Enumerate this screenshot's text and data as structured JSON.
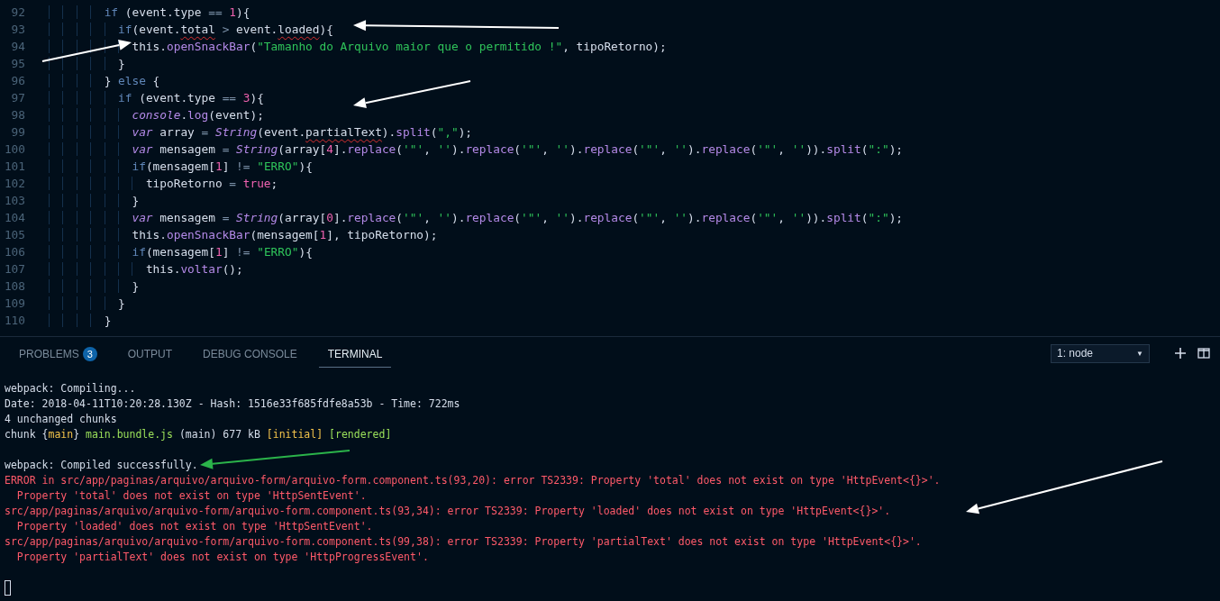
{
  "editor": {
    "lines": [
      {
        "number": "92",
        "tokens": [
          {
            "kind": "keyword",
            "text": "        if"
          },
          {
            "kind": "plain",
            "text": " (event.type "
          },
          {
            "kind": "operator",
            "text": "=="
          },
          {
            "kind": "number",
            "text": " 1"
          },
          {
            "kind": "plain",
            "text": "){"
          }
        ]
      },
      {
        "number": "93",
        "tokens": [
          {
            "kind": "keyword",
            "text": "          if"
          },
          {
            "kind": "plain",
            "text": "(event."
          },
          {
            "kind": "error",
            "text": "total"
          },
          {
            "kind": "operator",
            "text": " >"
          },
          {
            "kind": "plain",
            "text": " event."
          },
          {
            "kind": "error",
            "text": "loaded"
          },
          {
            "kind": "plain",
            "text": "){"
          }
        ]
      },
      {
        "number": "94",
        "tokens": [
          {
            "kind": "plain",
            "text": "            this."
          },
          {
            "kind": "function",
            "text": "openSnackBar"
          },
          {
            "kind": "plain",
            "text": "("
          },
          {
            "kind": "string",
            "text": "\"Tamanho do Arquivo maior que o permitido !\""
          },
          {
            "kind": "plain",
            "text": ", tipoRetorno);"
          }
        ]
      },
      {
        "number": "95",
        "tokens": [
          {
            "kind": "plain",
            "text": "          }"
          }
        ]
      },
      {
        "number": "96",
        "tokens": [
          {
            "kind": "plain",
            "text": "        } "
          },
          {
            "kind": "keyword",
            "text": "else"
          },
          {
            "kind": "plain",
            "text": " {"
          }
        ]
      },
      {
        "number": "97",
        "tokens": [
          {
            "kind": "keyword",
            "text": "          if"
          },
          {
            "kind": "plain",
            "text": " (event.type "
          },
          {
            "kind": "operator",
            "text": "=="
          },
          {
            "kind": "number",
            "text": " 3"
          },
          {
            "kind": "plain",
            "text": "){"
          }
        ]
      },
      {
        "number": "98",
        "tokens": [
          {
            "kind": "italic",
            "text": "            console"
          },
          {
            "kind": "plain",
            "text": "."
          },
          {
            "kind": "function",
            "text": "log"
          },
          {
            "kind": "plain",
            "text": "(event);"
          }
        ]
      },
      {
        "number": "99",
        "tokens": [
          {
            "kind": "italic",
            "text": "            var"
          },
          {
            "kind": "plain",
            "text": " array "
          },
          {
            "kind": "operator",
            "text": "="
          },
          {
            "kind": "italic",
            "text": " String"
          },
          {
            "kind": "plain",
            "text": "(event."
          },
          {
            "kind": "error",
            "text": "partialText"
          },
          {
            "kind": "plain",
            "text": ")."
          },
          {
            "kind": "function",
            "text": "split"
          },
          {
            "kind": "plain",
            "text": "("
          },
          {
            "kind": "string",
            "text": "\",\""
          },
          {
            "kind": "plain",
            "text": ");"
          }
        ]
      },
      {
        "number": "100",
        "tokens": [
          {
            "kind": "italic",
            "text": "            var"
          },
          {
            "kind": "plain",
            "text": " mensagem "
          },
          {
            "kind": "operator",
            "text": "="
          },
          {
            "kind": "italic",
            "text": " String"
          },
          {
            "kind": "plain",
            "text": "(array["
          },
          {
            "kind": "number",
            "text": "4"
          },
          {
            "kind": "plain",
            "text": "]."
          },
          {
            "kind": "function",
            "text": "replace"
          },
          {
            "kind": "plain",
            "text": "("
          },
          {
            "kind": "string",
            "text": "'\"'"
          },
          {
            "kind": "plain",
            "text": ", "
          },
          {
            "kind": "string",
            "text": "''"
          },
          {
            "kind": "plain",
            "text": ")."
          },
          {
            "kind": "function",
            "text": "replace"
          },
          {
            "kind": "plain",
            "text": "("
          },
          {
            "kind": "string",
            "text": "'\"'"
          },
          {
            "kind": "plain",
            "text": ", "
          },
          {
            "kind": "string",
            "text": "''"
          },
          {
            "kind": "plain",
            "text": ")."
          },
          {
            "kind": "function",
            "text": "replace"
          },
          {
            "kind": "plain",
            "text": "("
          },
          {
            "kind": "string",
            "text": "'\"'"
          },
          {
            "kind": "plain",
            "text": ", "
          },
          {
            "kind": "string",
            "text": "''"
          },
          {
            "kind": "plain",
            "text": ")."
          },
          {
            "kind": "function",
            "text": "replace"
          },
          {
            "kind": "plain",
            "text": "("
          },
          {
            "kind": "string",
            "text": "'\"'"
          },
          {
            "kind": "plain",
            "text": ", "
          },
          {
            "kind": "string",
            "text": "''"
          },
          {
            "kind": "plain",
            "text": "))."
          },
          {
            "kind": "function",
            "text": "split"
          },
          {
            "kind": "plain",
            "text": "("
          },
          {
            "kind": "string",
            "text": "\":\""
          },
          {
            "kind": "plain",
            "text": ");"
          }
        ]
      },
      {
        "number": "101",
        "tokens": [
          {
            "kind": "keyword",
            "text": "            if"
          },
          {
            "kind": "plain",
            "text": "(mensagem["
          },
          {
            "kind": "number",
            "text": "1"
          },
          {
            "kind": "plain",
            "text": "] "
          },
          {
            "kind": "operator",
            "text": "!="
          },
          {
            "kind": "string",
            "text": " \"ERRO\""
          },
          {
            "kind": "plain",
            "text": "){"
          }
        ]
      },
      {
        "number": "102",
        "tokens": [
          {
            "kind": "plain",
            "text": "              tipoRetorno "
          },
          {
            "kind": "operator",
            "text": "="
          },
          {
            "kind": "number",
            "text": " true"
          },
          {
            "kind": "plain",
            "text": ";"
          }
        ]
      },
      {
        "number": "103",
        "tokens": [
          {
            "kind": "plain",
            "text": "            }"
          }
        ]
      },
      {
        "number": "104",
        "tokens": [
          {
            "kind": "italic",
            "text": "            var"
          },
          {
            "kind": "plain",
            "text": " mensagem "
          },
          {
            "kind": "operator",
            "text": "="
          },
          {
            "kind": "italic",
            "text": " String"
          },
          {
            "kind": "plain",
            "text": "(array["
          },
          {
            "kind": "number",
            "text": "0"
          },
          {
            "kind": "plain",
            "text": "]."
          },
          {
            "kind": "function",
            "text": "replace"
          },
          {
            "kind": "plain",
            "text": "("
          },
          {
            "kind": "string",
            "text": "'\"'"
          },
          {
            "kind": "plain",
            "text": ", "
          },
          {
            "kind": "string",
            "text": "''"
          },
          {
            "kind": "plain",
            "text": ")."
          },
          {
            "kind": "function",
            "text": "replace"
          },
          {
            "kind": "plain",
            "text": "("
          },
          {
            "kind": "string",
            "text": "'\"'"
          },
          {
            "kind": "plain",
            "text": ", "
          },
          {
            "kind": "string",
            "text": "''"
          },
          {
            "kind": "plain",
            "text": ")."
          },
          {
            "kind": "function",
            "text": "replace"
          },
          {
            "kind": "plain",
            "text": "("
          },
          {
            "kind": "string",
            "text": "'\"'"
          },
          {
            "kind": "plain",
            "text": ", "
          },
          {
            "kind": "string",
            "text": "''"
          },
          {
            "kind": "plain",
            "text": ")."
          },
          {
            "kind": "function",
            "text": "replace"
          },
          {
            "kind": "plain",
            "text": "("
          },
          {
            "kind": "string",
            "text": "'\"'"
          },
          {
            "kind": "plain",
            "text": ", "
          },
          {
            "kind": "string",
            "text": "''"
          },
          {
            "kind": "plain",
            "text": "))."
          },
          {
            "kind": "function",
            "text": "split"
          },
          {
            "kind": "plain",
            "text": "("
          },
          {
            "kind": "string",
            "text": "\":\""
          },
          {
            "kind": "plain",
            "text": ");"
          }
        ]
      },
      {
        "number": "105",
        "tokens": [
          {
            "kind": "plain",
            "text": "            this."
          },
          {
            "kind": "function",
            "text": "openSnackBar"
          },
          {
            "kind": "plain",
            "text": "(mensagem["
          },
          {
            "kind": "number",
            "text": "1"
          },
          {
            "kind": "plain",
            "text": "], tipoRetorno);"
          }
        ]
      },
      {
        "number": "106",
        "tokens": [
          {
            "kind": "keyword",
            "text": "            if"
          },
          {
            "kind": "plain",
            "text": "(mensagem["
          },
          {
            "kind": "number",
            "text": "1"
          },
          {
            "kind": "plain",
            "text": "] "
          },
          {
            "kind": "operator",
            "text": "!="
          },
          {
            "kind": "string",
            "text": " \"ERRO\""
          },
          {
            "kind": "plain",
            "text": "){"
          }
        ]
      },
      {
        "number": "107",
        "tokens": [
          {
            "kind": "plain",
            "text": "              this."
          },
          {
            "kind": "function",
            "text": "voltar"
          },
          {
            "kind": "plain",
            "text": "();"
          }
        ]
      },
      {
        "number": "108",
        "tokens": [
          {
            "kind": "plain",
            "text": "            }"
          }
        ]
      },
      {
        "number": "109",
        "tokens": [
          {
            "kind": "plain",
            "text": "          }"
          }
        ]
      },
      {
        "number": "110",
        "tokens": [
          {
            "kind": "plain",
            "text": "        }"
          }
        ]
      }
    ]
  },
  "panel": {
    "tabs": [
      {
        "label": "PROBLEMS",
        "badge": "3",
        "selected": false
      },
      {
        "label": "OUTPUT",
        "selected": false
      },
      {
        "label": "DEBUG CONSOLE",
        "selected": false
      },
      {
        "label": "TERMINAL",
        "selected": true
      }
    ],
    "terminal_select": {
      "value": "1: node",
      "caret": "▼"
    },
    "terminal": {
      "blocks": [
        [
          {
            "segments": [
              {
                "kind": "plain",
                "text": "webpack: Compiling..."
              }
            ]
          },
          {
            "segments": [
              {
                "kind": "plain",
                "text": "Date: 2018-04-11T10:20:28.130Z - Hash: 1516e33f685fdfe8a53b - Time: 722ms"
              }
            ]
          },
          {
            "segments": [
              {
                "kind": "plain",
                "text": "4 unchanged chunks"
              }
            ]
          },
          {
            "segments": [
              {
                "kind": "plain",
                "text": "chunk {"
              },
              {
                "kind": "yellow",
                "text": "main"
              },
              {
                "kind": "plain",
                "text": "} "
              },
              {
                "kind": "green",
                "text": "main.bundle.js"
              },
              {
                "kind": "plain",
                "text": " (main) 677 kB "
              },
              {
                "kind": "yellow",
                "text": "[initial]"
              },
              {
                "kind": "green",
                "text": " [rendered]"
              }
            ]
          }
        ],
        [
          {
            "segments": [
              {
                "kind": "plain",
                "text": "webpack: Compiled successfully."
              }
            ]
          },
          {
            "segments": [
              {
                "kind": "error",
                "text": "ERROR in src/app/paginas/arquivo/arquivo-form/arquivo-form.component.ts(93,20): error TS2339: Property 'total' does not exist on type 'HttpEvent<{}>'."
              }
            ]
          },
          {
            "segments": [
              {
                "kind": "error",
                "text": "  Property 'total' does not exist on type 'HttpSentEvent'."
              }
            ]
          },
          {
            "segments": [
              {
                "kind": "error",
                "text": "src/app/paginas/arquivo/arquivo-form/arquivo-form.component.ts(93,34): error TS2339: Property 'loaded' does not exist on type 'HttpEvent<{}>'."
              }
            ]
          },
          {
            "segments": [
              {
                "kind": "error",
                "text": "  Property 'loaded' does not exist on type 'HttpSentEvent'."
              }
            ]
          },
          {
            "segments": [
              {
                "kind": "error",
                "text": "src/app/paginas/arquivo/arquivo-form/arquivo-form.component.ts(99,38): error TS2339: Property 'partialText' does not exist on type 'HttpEvent<{}>'."
              }
            ]
          },
          {
            "segments": [
              {
                "kind": "error",
                "text": "  Property 'partialText' does not exist on type 'HttpProgressEvent'."
              }
            ]
          }
        ]
      ]
    }
  }
}
